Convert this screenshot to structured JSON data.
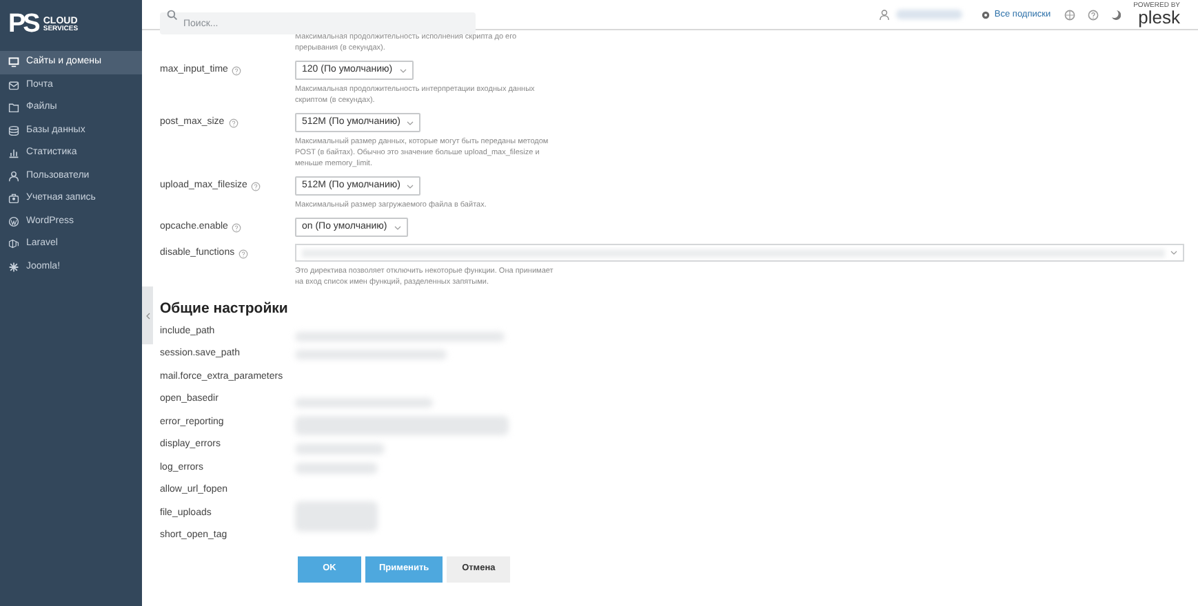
{
  "logo": {
    "mark": "PS",
    "line_1": "CLOUD",
    "line_2": "SERVICES"
  },
  "sidebar": {
    "items": [
      {
        "label": "Сайты и домены",
        "selected": true
      },
      {
        "label": "Почта",
        "selected": false
      },
      {
        "label": "Файлы",
        "selected": false
      },
      {
        "label": "Базы данных",
        "selected": false
      },
      {
        "label": "Статистика",
        "selected": false
      },
      {
        "label": "Пользователи",
        "selected": false
      },
      {
        "label": "Учетная запись",
        "selected": false
      },
      {
        "label": "WordPress",
        "selected": false
      },
      {
        "label": "Laravel",
        "selected": false
      },
      {
        "label": "Joomla!",
        "selected": false
      }
    ]
  },
  "header": {
    "search": {
      "placeholder": "Поиск..."
    },
    "subscriptions_link": "Все подписки",
    "brand_small": "POWERED BY",
    "brand": "plesk"
  },
  "top_hint": "Максимальная продолжительность исполнения скрипта до его прерывания (в секундах).",
  "settings": [
    {
      "name": "max_input_time",
      "kind": "select",
      "value": "120 (По умолчанию)",
      "hint": "Максимальная продолжительность интерпретации входных данных скриптом (в секундах)."
    },
    {
      "name": "post_max_size",
      "kind": "select",
      "value": "512M (По умолчанию)",
      "hint": "Максимальный размер данных, которые могут быть переданы методом POST (в байтах). Обычно это значение больше upload_max_filesize и меньше memory_limit."
    },
    {
      "name": "upload_max_filesize",
      "kind": "select",
      "value": "512M (По умолчанию)",
      "hint": "Максимальный размер загружаемого файла в байтах."
    },
    {
      "name": "opcache.enable",
      "kind": "select",
      "value": "on (По умолчанию)"
    },
    {
      "name": "disable_functions",
      "kind": "wide",
      "hint": "Это директива позволяет отключить некоторые функции. Она принимает на вход список имен функций, разделенных запятыми."
    }
  ],
  "general": {
    "title": "Общие настройки",
    "rows": [
      {
        "name": "include_path"
      },
      {
        "name": "session.save_path"
      },
      {
        "name": "mail.force_extra_parameters"
      },
      {
        "name": "open_basedir"
      },
      {
        "name": "error_reporting"
      },
      {
        "name": "display_errors"
      },
      {
        "name": "log_errors"
      },
      {
        "name": "allow_url_fopen"
      },
      {
        "name": "file_uploads"
      },
      {
        "name": "short_open_tag"
      }
    ]
  },
  "buttons": [
    {
      "label": "OK",
      "kind": "primary"
    },
    {
      "label": "Применить",
      "kind": "primary"
    },
    {
      "label": "Отмена",
      "kind": "secondary"
    }
  ]
}
